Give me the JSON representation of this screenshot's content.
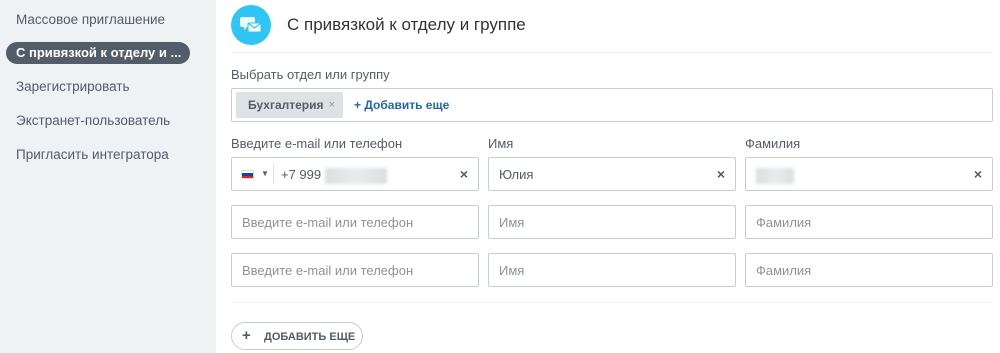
{
  "sidebar": {
    "items": [
      {
        "label": "Массовое приглашение"
      },
      {
        "label": "С привязкой к отделу и ..."
      },
      {
        "label": "Зарегистрировать"
      },
      {
        "label": "Экстранет-пользователь"
      },
      {
        "label": "Пригласить интегратора"
      }
    ]
  },
  "header": {
    "title": "С привязкой к отделу и группе",
    "icon": "chat-invite-icon",
    "icon_color": "#2fc6f6"
  },
  "dept_selector": {
    "label": "Выбрать отдел или группу",
    "tag": "Бухгалтерия",
    "tag_remove": "×",
    "add_link": "+ Добавить еще"
  },
  "columns": {
    "contact": "Введите e-mail или телефон",
    "first_name": "Имя",
    "last_name": "Фамилия"
  },
  "rows": [
    {
      "country_flag": "ru-flag-icon",
      "phone_value": "+7 999",
      "first_name_value": "Юлия",
      "clear": "×"
    },
    {
      "contact_placeholder": "Введите e-mail или телефон",
      "first_name_placeholder": "Имя",
      "last_name_placeholder": "Фамилия"
    },
    {
      "contact_placeholder": "Введите e-mail или телефон",
      "first_name_placeholder": "Имя",
      "last_name_placeholder": "Фамилия"
    }
  ],
  "add_more_button": {
    "plus": "+",
    "label": "ДОБАВИТЬ ЕЩЕ"
  }
}
